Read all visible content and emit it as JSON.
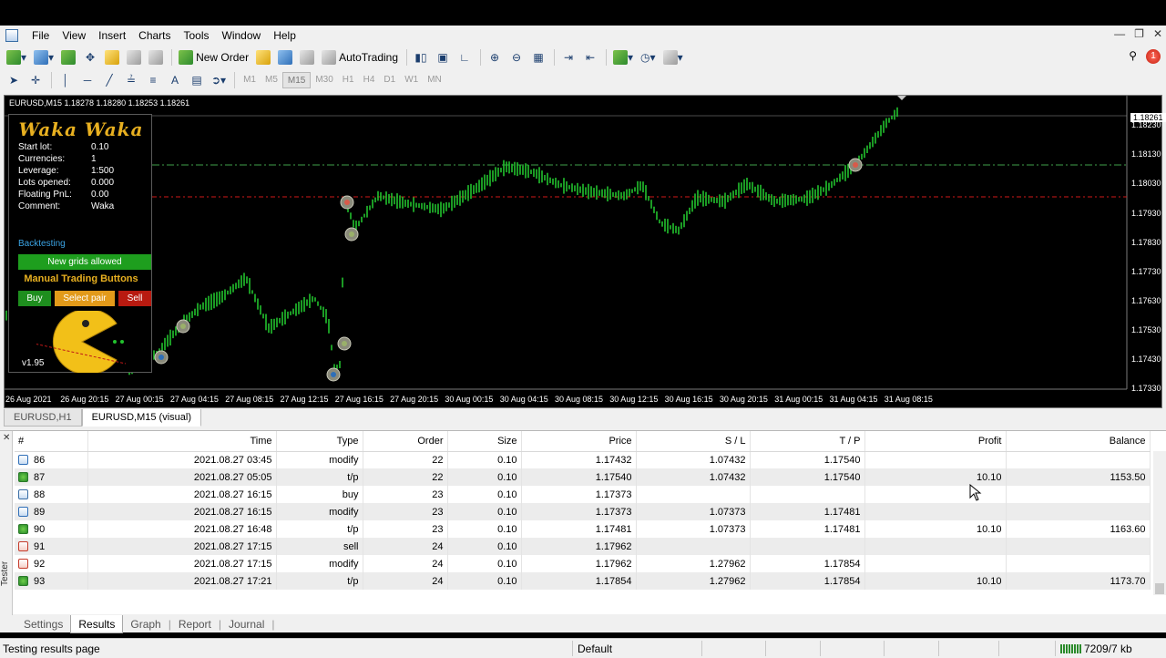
{
  "menu": [
    "File",
    "View",
    "Insert",
    "Charts",
    "Tools",
    "Window",
    "Help"
  ],
  "toolbar": {
    "new_order_label": "New Order",
    "autotrading_label": "AutoTrading",
    "timeframes": [
      "M1",
      "M5",
      "M15",
      "M30",
      "H1",
      "H4",
      "D1",
      "W1",
      "MN"
    ],
    "active_timeframe": "M15",
    "notification_count": "1"
  },
  "chart": {
    "title": "EURUSD,M15  1.18278 1.18280 1.18253 1.18261",
    "current_price": "1.18261",
    "price_axis": [
      "1.18230",
      "1.18130",
      "1.18030",
      "1.17930",
      "1.17830",
      "1.17730",
      "1.17630",
      "1.17530",
      "1.17430",
      "1.17330"
    ],
    "time_axis": [
      "26 Aug 2021",
      "26 Aug 20:15",
      "27 Aug 00:15",
      "27 Aug 04:15",
      "27 Aug 08:15",
      "27 Aug 12:15",
      "27 Aug 16:15",
      "27 Aug 20:15",
      "30 Aug 00:15",
      "30 Aug 04:15",
      "30 Aug 08:15",
      "30 Aug 12:15",
      "30 Aug 16:15",
      "30 Aug 20:15",
      "31 Aug 00:15",
      "31 Aug 04:15",
      "31 Aug 08:15"
    ]
  },
  "ea": {
    "logo": "Waka Waka",
    "fields": [
      {
        "key": "Start lot:",
        "value": "0.10"
      },
      {
        "key": "Currencies:",
        "value": "1"
      },
      {
        "key": "Leverage:",
        "value": "1:500"
      },
      {
        "key": "Lots opened:",
        "value": "0.000"
      },
      {
        "key": "Floating PnL:",
        "value": "0.00"
      },
      {
        "key": "Comment:",
        "value": "Waka"
      }
    ],
    "backtesting": "Backtesting",
    "grids_status": "New grids allowed",
    "manual_title": "Manual Trading Buttons",
    "buy": "Buy",
    "select_pair": "Select pair",
    "sell": "Sell",
    "version": "v1.95"
  },
  "chart_tabs": [
    "EURUSD,H1",
    "EURUSD,M15 (visual)"
  ],
  "results": {
    "columns": [
      "#",
      "Time",
      "Type",
      "Order",
      "Size",
      "Price",
      "S / L",
      "T / P",
      "Profit",
      "Balance"
    ],
    "rows": [
      {
        "n": "86",
        "time": "2021.08.27 03:45",
        "type": "modify",
        "order": "22",
        "size": "0.10",
        "price": "1.17432",
        "sl": "1.07432",
        "tp": "1.17540",
        "profit": "",
        "balance": "",
        "icon": "modify"
      },
      {
        "n": "87",
        "time": "2021.08.27 05:05",
        "type": "t/p",
        "order": "22",
        "size": "0.10",
        "price": "1.17540",
        "sl": "1.07432",
        "tp": "1.17540",
        "profit": "10.10",
        "balance": "1153.50",
        "icon": "tp"
      },
      {
        "n": "88",
        "time": "2021.08.27 16:15",
        "type": "buy",
        "order": "23",
        "size": "0.10",
        "price": "1.17373",
        "sl": "",
        "tp": "",
        "profit": "",
        "balance": "",
        "icon": "buy"
      },
      {
        "n": "89",
        "time": "2021.08.27 16:15",
        "type": "modify",
        "order": "23",
        "size": "0.10",
        "price": "1.17373",
        "sl": "1.07373",
        "tp": "1.17481",
        "profit": "",
        "balance": "",
        "icon": "modify"
      },
      {
        "n": "90",
        "time": "2021.08.27 16:48",
        "type": "t/p",
        "order": "23",
        "size": "0.10",
        "price": "1.17481",
        "sl": "1.07373",
        "tp": "1.17481",
        "profit": "10.10",
        "balance": "1163.60",
        "icon": "tp"
      },
      {
        "n": "91",
        "time": "2021.08.27 17:15",
        "type": "sell",
        "order": "24",
        "size": "0.10",
        "price": "1.17962",
        "sl": "",
        "tp": "",
        "profit": "",
        "balance": "",
        "icon": "sell"
      },
      {
        "n": "92",
        "time": "2021.08.27 17:15",
        "type": "modify",
        "order": "24",
        "size": "0.10",
        "price": "1.17962",
        "sl": "1.27962",
        "tp": "1.17854",
        "profit": "",
        "balance": "",
        "icon": "sell"
      },
      {
        "n": "93",
        "time": "2021.08.27 17:21",
        "type": "t/p",
        "order": "24",
        "size": "0.10",
        "price": "1.17854",
        "sl": "1.27962",
        "tp": "1.17854",
        "profit": "10.10",
        "balance": "1173.70",
        "icon": "tp"
      }
    ]
  },
  "tester": {
    "side_label": "Tester",
    "tabs": [
      "Settings",
      "Results",
      "Graph",
      "Report",
      "Journal"
    ],
    "active_tab": "Results"
  },
  "status": {
    "text": "Testing results page",
    "profile": "Default",
    "traffic": "7209/7 kb"
  },
  "colors": {
    "candle": "#22c22e",
    "buy_line": "#3fa04a",
    "sell_line": "#d01818",
    "ea_gold": "#e8b020"
  }
}
